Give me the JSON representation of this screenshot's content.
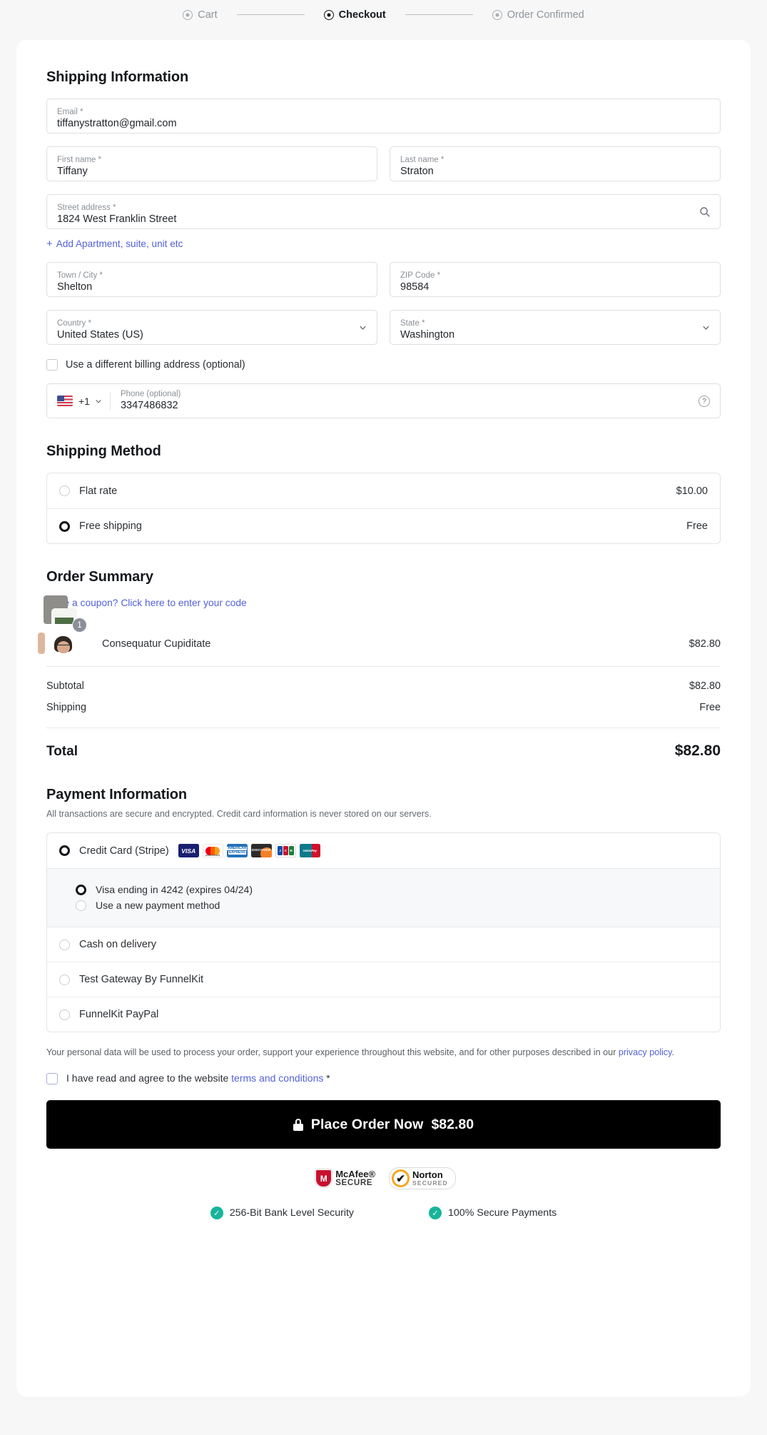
{
  "steps": [
    {
      "label": "Cart",
      "active": false
    },
    {
      "label": "Checkout",
      "active": true
    },
    {
      "label": "Order Confirmed",
      "active": false
    }
  ],
  "shipping": {
    "title": "Shipping Information",
    "email": {
      "label": "Email *",
      "value": "tiffanystratton@gmail.com"
    },
    "first_name": {
      "label": "First name *",
      "value": "Tiffany"
    },
    "last_name": {
      "label": "Last name *",
      "value": "Straton"
    },
    "street": {
      "label": "Street address *",
      "value": "1824 West Franklin Street",
      "icon": "search-icon"
    },
    "add_apartment": "Add Apartment, suite, unit etc",
    "city": {
      "label": "Town / City *",
      "value": "Shelton"
    },
    "zip": {
      "label": "ZIP Code *",
      "value": "98584"
    },
    "country": {
      "label": "Country *",
      "value": "United States (US)"
    },
    "state": {
      "label": "State *",
      "value": "Washington"
    },
    "billing_checkbox": {
      "label": "Use a different billing address (optional)",
      "checked": false
    },
    "phone": {
      "label": "Phone (optional)",
      "value": "3347486832",
      "dial_code": "+1",
      "flag": "us-flag-icon"
    }
  },
  "shipping_method": {
    "title": "Shipping Method",
    "options": [
      {
        "label": "Flat rate",
        "price": "$10.00",
        "selected": false
      },
      {
        "label": "Free shipping",
        "price": "Free",
        "selected": true
      }
    ]
  },
  "order_summary": {
    "title": "Order Summary",
    "coupon_link": "Have a coupon? Click here to enter your code",
    "items": [
      {
        "name": "Consequatur Cupiditate",
        "qty": "1",
        "price": "$82.80"
      }
    ],
    "rows": [
      {
        "label": "Subtotal",
        "value": "$82.80"
      },
      {
        "label": "Shipping",
        "value": "Free"
      }
    ],
    "total_label": "Total",
    "total_value": "$82.80"
  },
  "payment": {
    "title": "Payment Information",
    "subtitle": "All transactions are secure and encrypted. Credit card information is never stored on our servers.",
    "methods": [
      {
        "label": "Credit Card (Stripe)",
        "selected": true,
        "cards": [
          "visa",
          "mastercard",
          "amex",
          "discover",
          "jcb",
          "unionpay"
        ]
      },
      {
        "label": "Cash on delivery",
        "selected": false
      },
      {
        "label": "Test Gateway By FunnelKit",
        "selected": false
      },
      {
        "label": "FunnelKit PayPal",
        "selected": false
      }
    ],
    "saved_cards": [
      {
        "label": "Visa ending in 4242 (expires 04/24)",
        "selected": true
      },
      {
        "label": "Use a new payment method",
        "selected": false
      }
    ],
    "card_labels": {
      "visa": "VISA",
      "mc_line1": "mastercard",
      "amex_1": "AMERICAN",
      "amex_2": "EXPRESS",
      "discover": "DISCOVER",
      "jcb_j": "J",
      "jcb_c": "C",
      "jcb_b": "B",
      "unionpay": "UnionPay"
    }
  },
  "legal": {
    "text_1": "Your personal data will be used to process your order, support your experience throughout this website, and for other purposes described in our ",
    "privacy_link": "privacy policy",
    "text_2": ".",
    "terms_prefix": "I have read and agree to the website ",
    "terms_link": "terms and conditions",
    "terms_suffix": " *",
    "terms_checked": false
  },
  "cta": {
    "lock_icon": "lock-icon",
    "label": "Place Order Now",
    "amount": "$82.80"
  },
  "trust": {
    "mcafee": {
      "mark": "M",
      "line1": "McAfee®",
      "line2": "SECURE"
    },
    "norton": {
      "mark": "✔",
      "line1": "Norton",
      "line2": "SECURED"
    },
    "assurances": [
      {
        "icon": "check-circle-icon",
        "label": "256-Bit Bank Level Security"
      },
      {
        "icon": "check-circle-icon",
        "label": "100% Secure Payments"
      }
    ]
  },
  "colors": {
    "accent_link": "#5361d9",
    "cta_bg": "#000000",
    "tick_green": "#16b59a",
    "badge_grey": "#8c8f98"
  }
}
